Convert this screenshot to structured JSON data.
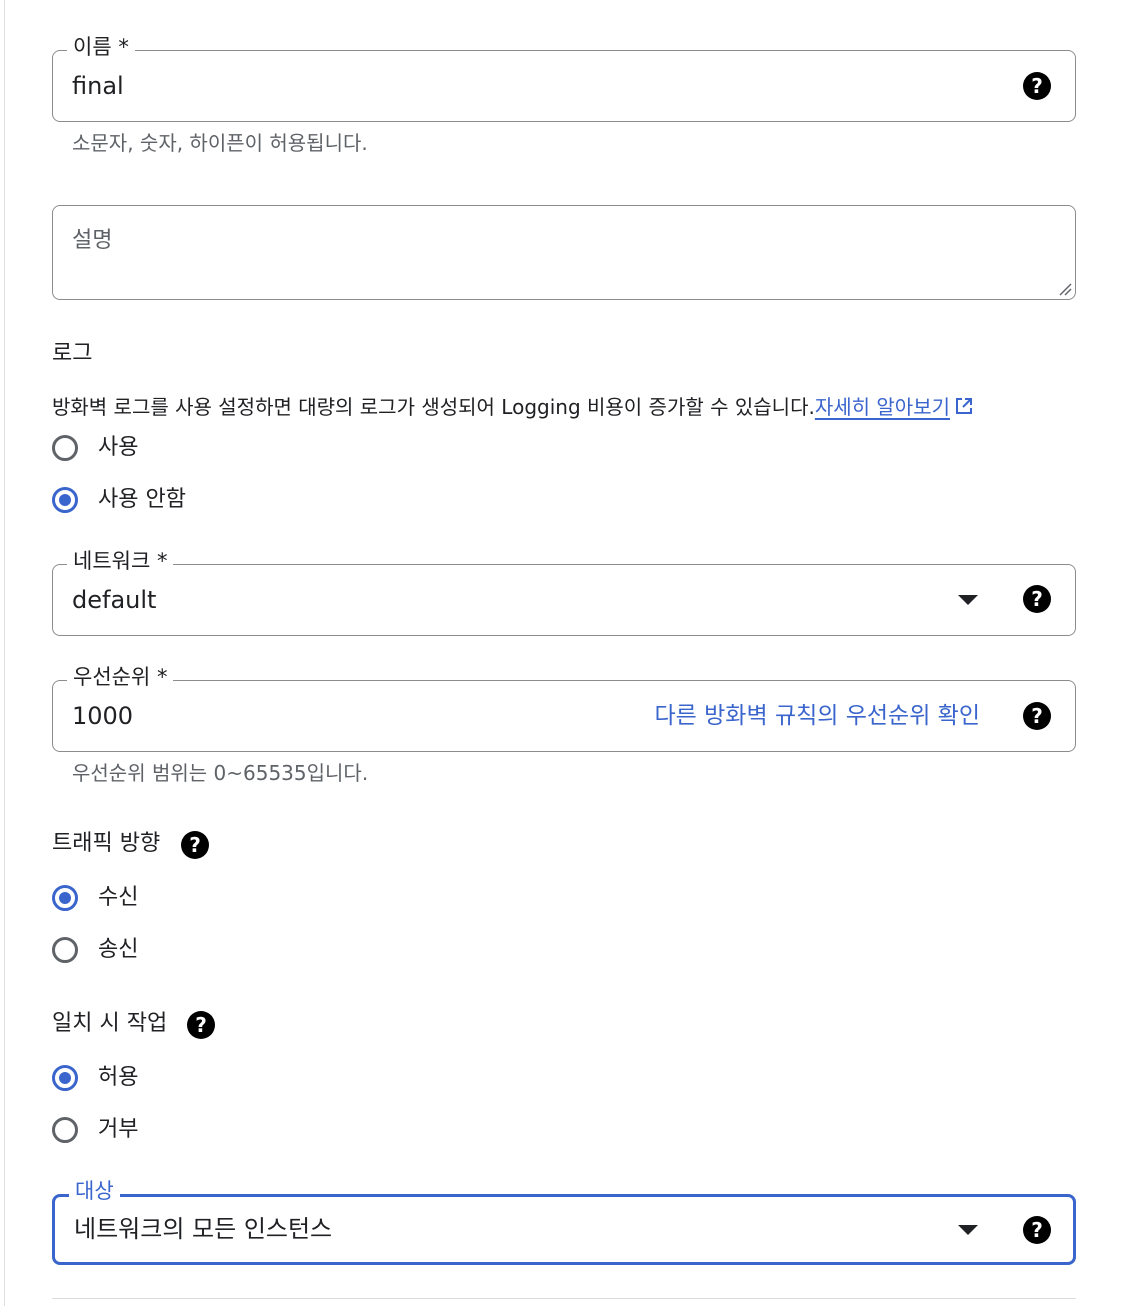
{
  "name_field": {
    "label": "이름 *",
    "value": "final",
    "hint": "소문자, 숫자, 하이픈이 허용됩니다."
  },
  "description_field": {
    "placeholder": "설명"
  },
  "logs": {
    "heading": "로그",
    "description": "방화벽 로그를 사용 설정하면 대량의 로그가 생성되어 Logging 비용이 증가할 수 있습니다.",
    "learn_more": "자세히 알아보기",
    "options": [
      {
        "label": "사용",
        "checked": false
      },
      {
        "label": "사용 안함",
        "checked": true
      }
    ]
  },
  "network_field": {
    "label": "네트워크 *",
    "value": "default"
  },
  "priority_field": {
    "label": "우선순위 *",
    "value": "1000",
    "link": "다른 방화벽 규칙의 우선순위 확인",
    "hint": "우선순위 범위는 0~65535입니다."
  },
  "traffic_direction": {
    "heading": "트래픽 방향",
    "options": [
      {
        "label": "수신",
        "checked": true
      },
      {
        "label": "송신",
        "checked": false
      }
    ]
  },
  "action_on_match": {
    "heading": "일치 시 작업",
    "options": [
      {
        "label": "허용",
        "checked": true
      },
      {
        "label": "거부",
        "checked": false
      }
    ]
  },
  "target_field": {
    "label": "대상",
    "value": "네트워크의 모든 인스턴스"
  },
  "icons": {
    "help": "help-circle-icon",
    "dropdown": "dropdown-caret-icon",
    "external": "external-link-icon"
  },
  "colors": {
    "accent": "#3a65cc",
    "border": "#8c8c8c",
    "hint": "#5f6368"
  }
}
